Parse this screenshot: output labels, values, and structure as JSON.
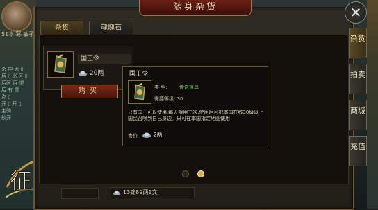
{
  "window": {
    "title": "随身杂货",
    "close_glyph": "✕"
  },
  "tabs": [
    {
      "label": "杂货",
      "active": true
    },
    {
      "label": "魂魄石",
      "active": false
    }
  ],
  "item": {
    "name": "国王令",
    "price": "20两",
    "buy_label": "购买"
  },
  "tooltip": {
    "title": "国王令",
    "type_label": "类  型:",
    "type_value": "传送道具",
    "level": "需要等级: 30",
    "description": "只有国王可以使用,每天限用三次,使用后可把本国在线30级以上国民召唤到自己身边。只可在本国指定地图使用",
    "price_label": "售价",
    "price_value": "2两"
  },
  "pagination": {
    "total": 2,
    "current": 2
  },
  "currency": {
    "amount": "13锭89两1文"
  },
  "side_tabs": [
    {
      "label": "杂货",
      "active": true
    },
    {
      "label": "拍卖",
      "active": false
    },
    {
      "label": "商城",
      "active": false
    },
    {
      "label": "充值",
      "active": false
    }
  ],
  "left_panel": {
    "player_name": "51本 寒 敏子",
    "lines": [
      "杀 中 大 ▯",
      "后 ▯ 巡 区 ▯",
      "后区 百 逆",
      "后 有 雪",
      "点 ▯",
      "开 ▯ 开 ▯",
      "主骑",
      "较开"
    ]
  },
  "logo_text": "征途",
  "colors": {
    "accent_gold": "#e0b040",
    "buy_red": "#7b2a1a",
    "type_green": "#7fd06a"
  },
  "icons": [
    "close-icon",
    "token-item-icon",
    "silver-ingot-icon",
    "coin-icon"
  ]
}
